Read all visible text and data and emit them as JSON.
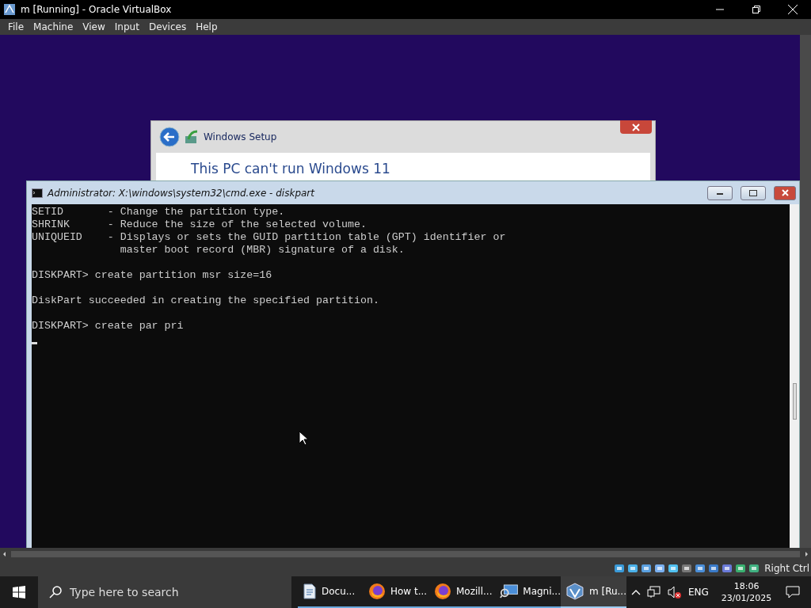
{
  "window": {
    "title": "m [Running] - Oracle VirtualBox"
  },
  "menu": [
    "File",
    "Machine",
    "View",
    "Input",
    "Devices",
    "Help"
  ],
  "setup_dialog": {
    "title": "Windows Setup",
    "heading": "This PC can't run Windows 11"
  },
  "console": {
    "title": "Administrator: X:\\windows\\system32\\cmd.exe - diskpart",
    "cursor": true,
    "blocks": [
      [
        "SETID       - Change the partition type.",
        "SHRINK      - Reduce the size of the selected volume.",
        "UNIQUEID    - Displays or sets the GUID partition table (GPT) identifier or",
        "              master boot record (MBR) signature of a disk."
      ],
      [
        "DISKPART> create partition msr size=16"
      ],
      [
        "DiskPart succeeded in creating the specified partition."
      ],
      [
        "DISKPART> create par pri"
      ]
    ]
  },
  "status_bar": {
    "host_key": "Right Ctrl"
  },
  "taskbar": {
    "search": {
      "placeholder": "Type here to search"
    },
    "apps": [
      {
        "label": "Docu...",
        "kind": "document",
        "selected": false
      },
      {
        "label": "How t...",
        "kind": "browser",
        "selected": false
      },
      {
        "label": "Mozill...",
        "kind": "browser",
        "selected": false
      },
      {
        "label": "Magni...",
        "kind": "magnifier",
        "selected": false
      },
      {
        "label": "m [Ru...",
        "kind": "virtualbox",
        "selected": true
      }
    ],
    "language": "ENG",
    "time": "18:06",
    "date": "23/01/2025"
  }
}
